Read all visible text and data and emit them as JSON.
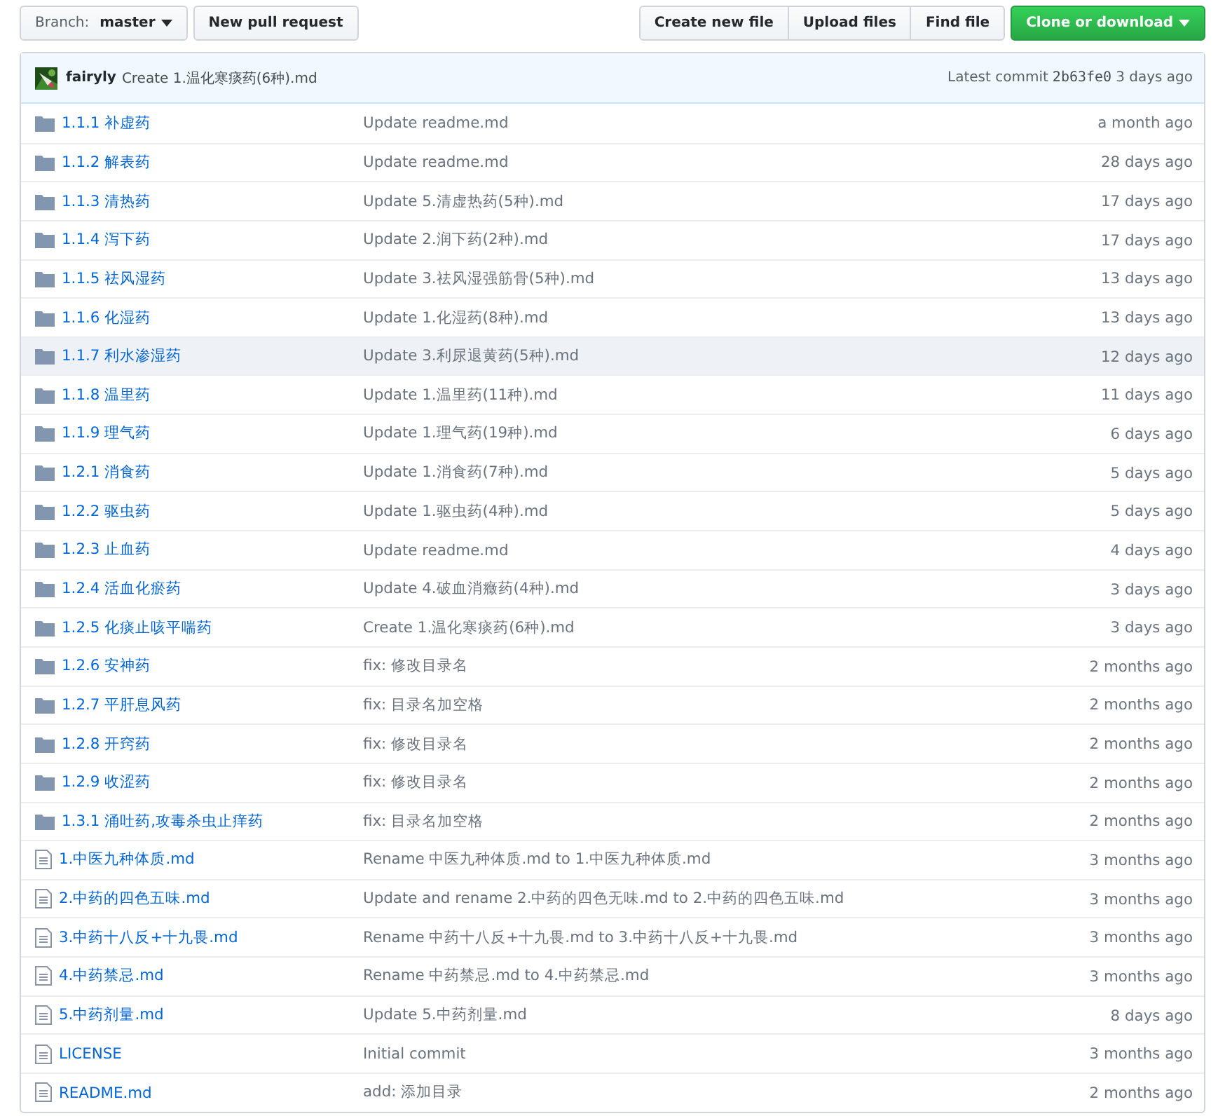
{
  "toolbar": {
    "branch_label": "Branch:",
    "branch": "master",
    "new_pull_request": "New pull request",
    "actions": [
      "Create new file",
      "Upload files",
      "Find file"
    ],
    "clone": "Clone or download"
  },
  "commit": {
    "author": "fairyly",
    "message": "Create 1.温化寒痰药(6种).md",
    "latest_label": "Latest commit",
    "hash": "2b63fe0",
    "age": "3 days ago"
  },
  "files": [
    {
      "kind": "folder",
      "name": "1.1.1 补虚药",
      "message": "Update readme.md",
      "age": "a month ago",
      "selected": false
    },
    {
      "kind": "folder",
      "name": "1.1.2 解表药",
      "message": "Update readme.md",
      "age": "28 days ago",
      "selected": false
    },
    {
      "kind": "folder",
      "name": "1.1.3 清热药",
      "message": "Update 5.清虚热药(5种).md",
      "age": "17 days ago",
      "selected": false
    },
    {
      "kind": "folder",
      "name": "1.1.4 泻下药",
      "message": "Update 2.润下药(2种).md",
      "age": "17 days ago",
      "selected": false
    },
    {
      "kind": "folder",
      "name": "1.1.5 祛风湿药",
      "message": "Update 3.祛风湿强筋骨(5种).md",
      "age": "13 days ago",
      "selected": false
    },
    {
      "kind": "folder",
      "name": "1.1.6 化湿药",
      "message": "Update 1.化湿药(8种).md",
      "age": "13 days ago",
      "selected": false
    },
    {
      "kind": "folder",
      "name": "1.1.7 利水渗湿药",
      "message": "Update 3.利尿退黄药(5种).md",
      "age": "12 days ago",
      "selected": true
    },
    {
      "kind": "folder",
      "name": "1.1.8 温里药",
      "message": "Update 1.温里药(11种).md",
      "age": "11 days ago",
      "selected": false
    },
    {
      "kind": "folder",
      "name": "1.1.9 理气药",
      "message": "Update 1.理气药(19种).md",
      "age": "6 days ago",
      "selected": false
    },
    {
      "kind": "folder",
      "name": "1.2.1 消食药",
      "message": "Update 1.消食药(7种).md",
      "age": "5 days ago",
      "selected": false
    },
    {
      "kind": "folder",
      "name": "1.2.2 驱虫药",
      "message": "Update 1.驱虫药(4种).md",
      "age": "5 days ago",
      "selected": false
    },
    {
      "kind": "folder",
      "name": "1.2.3 止血药",
      "message": "Update readme.md",
      "age": "4 days ago",
      "selected": false
    },
    {
      "kind": "folder",
      "name": "1.2.4 活血化瘀药",
      "message": "Update 4.破血消癥药(4种).md",
      "age": "3 days ago",
      "selected": false
    },
    {
      "kind": "folder",
      "name": "1.2.5 化痰止咳平喘药",
      "message": "Create 1.温化寒痰药(6种).md",
      "age": "3 days ago",
      "selected": false
    },
    {
      "kind": "folder",
      "name": "1.2.6 安神药",
      "message": "fix: 修改目录名",
      "age": "2 months ago",
      "selected": false
    },
    {
      "kind": "folder",
      "name": "1.2.7 平肝息风药",
      "message": "fix: 目录名加空格",
      "age": "2 months ago",
      "selected": false
    },
    {
      "kind": "folder",
      "name": "1.2.8 开窍药",
      "message": "fix: 修改目录名",
      "age": "2 months ago",
      "selected": false
    },
    {
      "kind": "folder",
      "name": "1.2.9 收涩药",
      "message": "fix: 修改目录名",
      "age": "2 months ago",
      "selected": false
    },
    {
      "kind": "folder",
      "name": "1.3.1 涌吐药,攻毒杀虫止痒药",
      "message": "fix: 目录名加空格",
      "age": "2 months ago",
      "selected": false
    },
    {
      "kind": "file",
      "name": "1.中医九种体质.md",
      "message": "Rename 中医九种体质.md to 1.中医九种体质.md",
      "age": "3 months ago",
      "selected": false
    },
    {
      "kind": "file",
      "name": "2.中药的四色五味.md",
      "message": "Update and rename 2.中药的四色无味.md to 2.中药的四色五味.md",
      "age": "3 months ago",
      "selected": false
    },
    {
      "kind": "file",
      "name": "3.中药十八反+十九畏.md",
      "message": "Rename 中药十八反+十九畏.md to 3.中药十八反+十九畏.md",
      "age": "3 months ago",
      "selected": false
    },
    {
      "kind": "file",
      "name": "4.中药禁忌.md",
      "message": "Rename 中药禁忌.md to 4.中药禁忌.md",
      "age": "3 months ago",
      "selected": false
    },
    {
      "kind": "file",
      "name": "5.中药剂量.md",
      "message": "Update 5.中药剂量.md",
      "age": "8 days ago",
      "selected": false
    },
    {
      "kind": "file",
      "name": "LICENSE",
      "message": "Initial commit",
      "age": "3 months ago",
      "selected": false
    },
    {
      "kind": "file",
      "name": "README.md",
      "message": "add: 添加目录",
      "age": "2 months ago",
      "selected": false
    }
  ]
}
